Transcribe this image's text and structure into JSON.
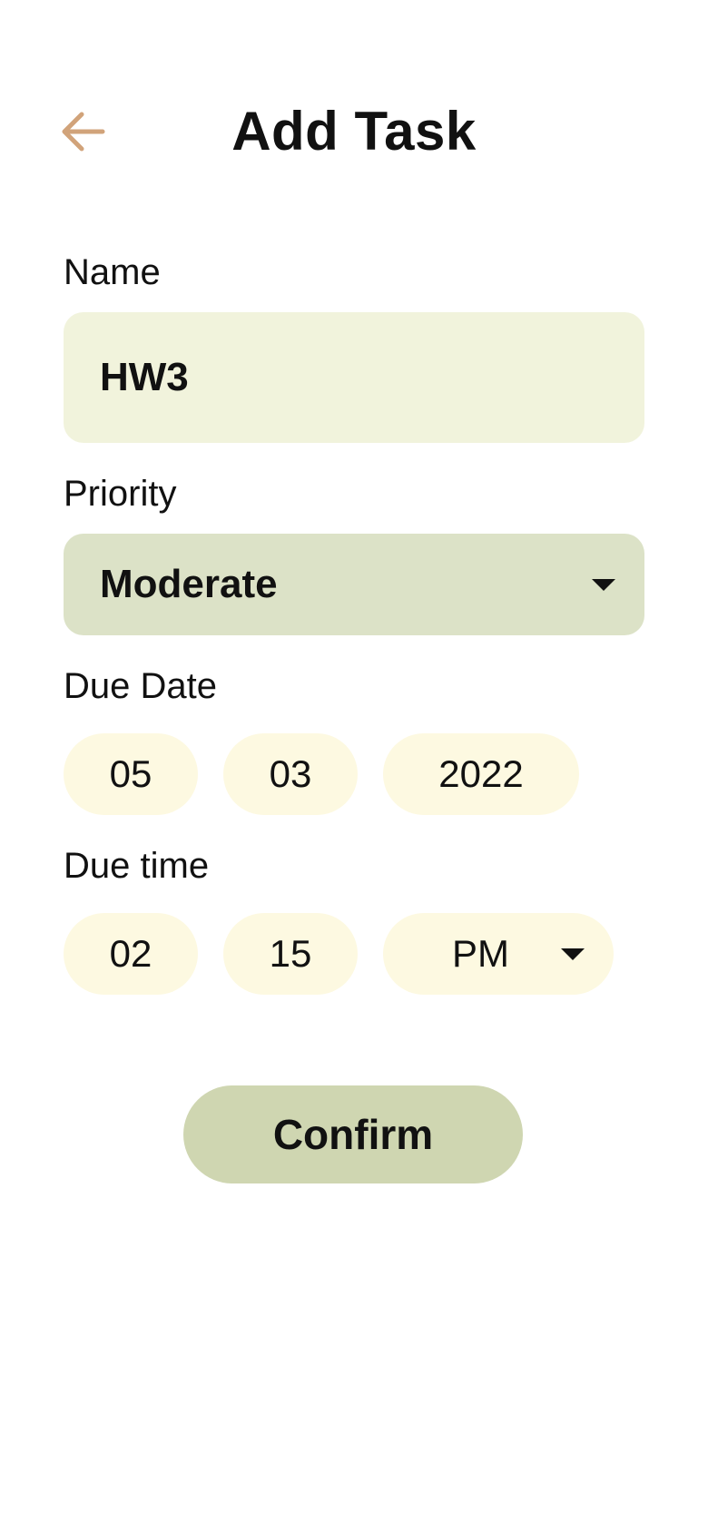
{
  "header": {
    "title": "Add Task",
    "back_icon": "arrow-left-icon",
    "back_icon_color": "#d1a37a"
  },
  "name": {
    "label": "Name",
    "value": "HW3"
  },
  "priority": {
    "label": "Priority",
    "selected": "Moderate"
  },
  "due_date": {
    "label": "Due Date",
    "month": "05",
    "day": "03",
    "year": "2022"
  },
  "due_time": {
    "label": "Due time",
    "hour": "02",
    "minute": "15",
    "period": "PM"
  },
  "confirm": {
    "label": "Confirm"
  },
  "colors": {
    "name_field_bg": "#f1f3dc",
    "priority_field_bg": "#dce2c7",
    "pill_bg": "#fdf9e1",
    "confirm_bg": "#cfd6b1"
  }
}
